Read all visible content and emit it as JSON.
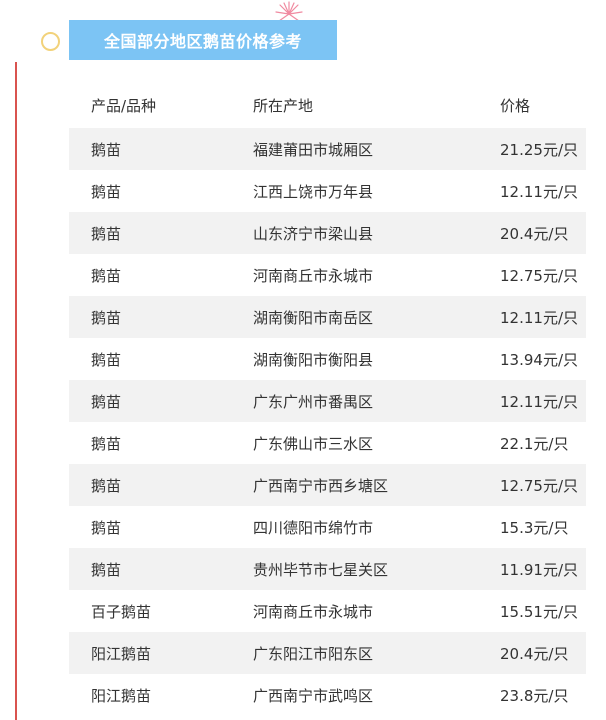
{
  "title": "全国部分地区鹅苗价格参考",
  "table": {
    "headers": [
      "产品/品种",
      "所在产地",
      "价格"
    ],
    "rows": [
      [
        "鹅苗",
        "福建莆田市城厢区",
        "21.25元/只"
      ],
      [
        "鹅苗",
        "江西上饶市万年县",
        "12.11元/只"
      ],
      [
        "鹅苗",
        "山东济宁市梁山县",
        "20.4元/只"
      ],
      [
        "鹅苗",
        "河南商丘市永城市",
        "12.75元/只"
      ],
      [
        "鹅苗",
        "湖南衡阳市南岳区",
        "12.11元/只"
      ],
      [
        "鹅苗",
        "湖南衡阳市衡阳县",
        "13.94元/只"
      ],
      [
        "鹅苗",
        "广东广州市番禺区",
        "12.11元/只"
      ],
      [
        "鹅苗",
        "广东佛山市三水区",
        "22.1元/只"
      ],
      [
        "鹅苗",
        "广西南宁市西乡塘区",
        "12.75元/只"
      ],
      [
        "鹅苗",
        "四川德阳市绵竹市",
        "15.3元/只"
      ],
      [
        "鹅苗",
        "贵州毕节市七星关区",
        "11.91元/只"
      ],
      [
        "百子鹅苗",
        "河南商丘市永城市",
        "15.51元/只"
      ],
      [
        "阳江鹅苗",
        "广东阳江市阳东区",
        "20.4元/只"
      ],
      [
        "阳江鹅苗",
        "广西南宁市武鸣区",
        "23.8元/只"
      ]
    ]
  },
  "colors": {
    "title_bg": "#7cc4f4",
    "row_shade": "#f2f2f2",
    "side_line": "#d9534f",
    "circle": "#f2d27a"
  }
}
